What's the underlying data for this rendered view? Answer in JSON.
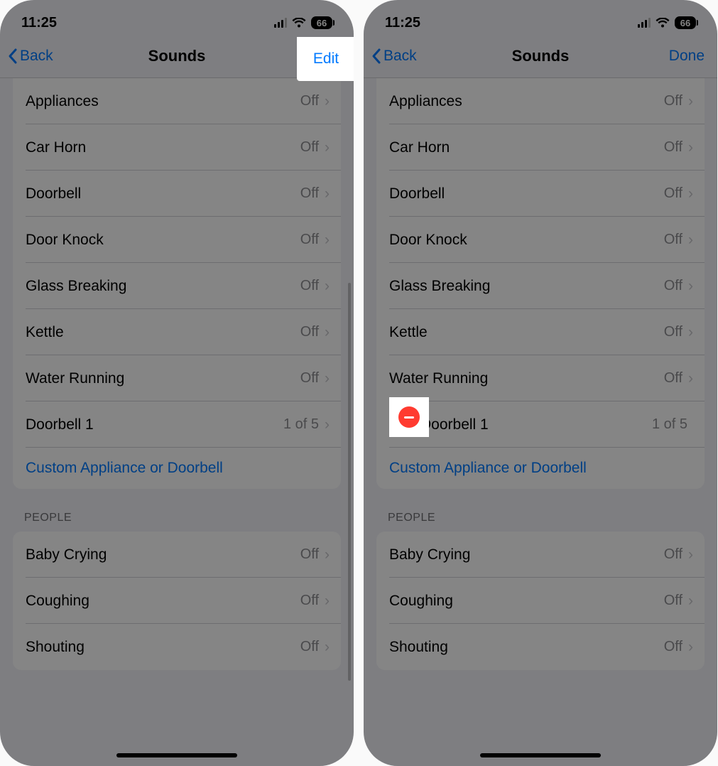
{
  "status": {
    "time": "11:25",
    "battery": "66"
  },
  "left": {
    "nav": {
      "back": "Back",
      "title": "Sounds",
      "right": "Edit"
    },
    "rows": [
      {
        "label": "Appliances",
        "value": "Off"
      },
      {
        "label": "Car Horn",
        "value": "Off"
      },
      {
        "label": "Doorbell",
        "value": "Off"
      },
      {
        "label": "Door Knock",
        "value": "Off"
      },
      {
        "label": "Glass Breaking",
        "value": "Off"
      },
      {
        "label": "Kettle",
        "value": "Off"
      },
      {
        "label": "Water Running",
        "value": "Off"
      },
      {
        "label": "Doorbell 1",
        "value": "1 of 5"
      }
    ],
    "custom_link": "Custom Appliance or Doorbell",
    "section_people": "PEOPLE",
    "people_rows": [
      {
        "label": "Baby Crying",
        "value": "Off"
      },
      {
        "label": "Coughing",
        "value": "Off"
      },
      {
        "label": "Shouting",
        "value": "Off"
      }
    ]
  },
  "right": {
    "nav": {
      "back": "Back",
      "title": "Sounds",
      "right": "Done"
    },
    "rows": [
      {
        "label": "Appliances",
        "value": "Off"
      },
      {
        "label": "Car Horn",
        "value": "Off"
      },
      {
        "label": "Doorbell",
        "value": "Off"
      },
      {
        "label": "Door Knock",
        "value": "Off"
      },
      {
        "label": "Glass Breaking",
        "value": "Off"
      },
      {
        "label": "Kettle",
        "value": "Off"
      },
      {
        "label": "Water Running",
        "value": "Off"
      },
      {
        "label": "Doorbell 1",
        "value": "1 of 5",
        "deletable": true
      }
    ],
    "custom_link": "Custom Appliance or Doorbell",
    "section_people": "PEOPLE",
    "people_rows": [
      {
        "label": "Baby Crying",
        "value": "Off"
      },
      {
        "label": "Coughing",
        "value": "Off"
      },
      {
        "label": "Shouting",
        "value": "Off"
      }
    ]
  }
}
